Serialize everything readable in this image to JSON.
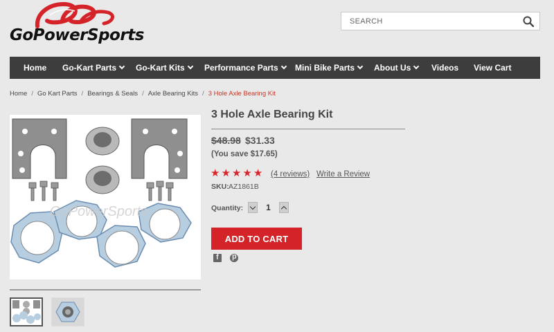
{
  "header": {
    "logo_text": "GoPowerSports",
    "logo_color": "#d4242a",
    "search_placeholder": "SEARCH"
  },
  "nav": {
    "items": [
      {
        "label": "Home",
        "dropdown": false
      },
      {
        "label": "Go-Kart Parts",
        "dropdown": true
      },
      {
        "label": "Go-Kart Kits",
        "dropdown": true
      },
      {
        "label": "Performance Parts",
        "dropdown": true
      },
      {
        "label": "Mini Bike Parts",
        "dropdown": true
      },
      {
        "label": "About Us",
        "dropdown": true
      },
      {
        "label": "Videos",
        "dropdown": false
      },
      {
        "label": "View Cart",
        "dropdown": false
      }
    ]
  },
  "breadcrumb": {
    "items": [
      "Home",
      "Go Kart Parts",
      "Bearings & Seals",
      "Axle Bearing Kits"
    ],
    "current": "3 Hole Axle Bearing Kit",
    "separator": "/"
  },
  "product": {
    "title": "3 Hole Axle Bearing Kit",
    "old_price": "$48.98",
    "new_price": "$31.33",
    "savings": "(You save $17.65)",
    "rating_stars": 5,
    "reviews_link": "(4 reviews)",
    "write_review": "Write a Review",
    "sku_label": "SKU:",
    "sku_value": "AZ1861B",
    "quantity_label": "Quantity:",
    "quantity_value": "1",
    "add_to_cart": "ADD TO CART",
    "image_watermark": "GoPowerSports",
    "accent_color": "#d4242a"
  },
  "social": {
    "icons": [
      "facebook-icon",
      "pinterest-icon"
    ]
  }
}
